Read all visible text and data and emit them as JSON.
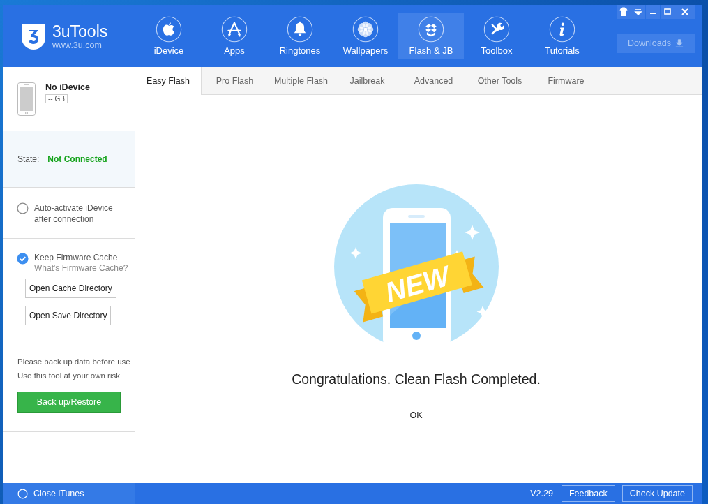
{
  "app": {
    "name": "3uTools",
    "url": "www.3u.com"
  },
  "nav": [
    {
      "label": "iDevice",
      "selected": false
    },
    {
      "label": "Apps",
      "selected": false
    },
    {
      "label": "Ringtones",
      "selected": false
    },
    {
      "label": "Wallpapers",
      "selected": false
    },
    {
      "label": "Flash & JB",
      "selected": true
    },
    {
      "label": "Toolbox",
      "selected": false
    },
    {
      "label": "Tutorials",
      "selected": false
    }
  ],
  "downloads": {
    "label": "Downloads"
  },
  "device": {
    "name": "No iDevice",
    "capacity": "-- GB"
  },
  "state": {
    "label": "State:",
    "value": "Not Connected"
  },
  "options": [
    {
      "label": "Auto-activate iDevice after connection",
      "checked": false
    },
    {
      "label": "Keep Firmware Cache",
      "checked": true,
      "link": "What's Firmware Cache?"
    }
  ],
  "cache_buttons": [
    "Open Cache Directory",
    "Open Save Directory"
  ],
  "warnings": [
    "Please back up data before use",
    "Use this tool at your own risk"
  ],
  "backup_button": "Back up/Restore",
  "tabs": [
    {
      "label": "Easy Flash",
      "selected": true
    },
    {
      "label": "Pro Flash",
      "selected": false
    },
    {
      "label": "Multiple Flash",
      "selected": false
    },
    {
      "label": "Jailbreak",
      "selected": false
    },
    {
      "label": "Advanced",
      "selected": false
    },
    {
      "label": "Other Tools",
      "selected": false
    },
    {
      "label": "Firmware",
      "selected": false
    }
  ],
  "result": {
    "badge": "NEW",
    "message": "Congratulations. Clean Flash Completed.",
    "button": "OK"
  },
  "footer": {
    "close_itunes": {
      "label": "Close iTunes",
      "checked": false
    },
    "version": "V2.29",
    "buttons": [
      "Feedback",
      "Check Update"
    ]
  }
}
